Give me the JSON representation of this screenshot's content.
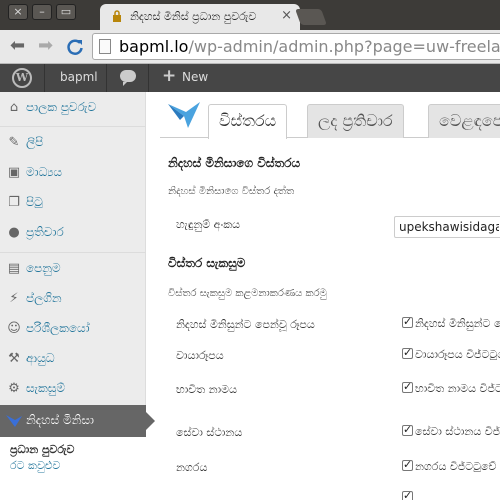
{
  "browser": {
    "tab_title": "නිදහස් මිනිස් ප්‍රධාන පුවරුව",
    "tab_close": "×",
    "url_host": "bapml.lo",
    "url_path": "/wp-admin/admin.php?page=uw-freelancer-settings",
    "window_buttons": [
      "×",
      "–",
      "▭"
    ]
  },
  "adminbar": {
    "logo": "W",
    "site_name": "bapml",
    "new_label": "New",
    "plus": "+"
  },
  "sidebar": {
    "items": [
      {
        "icon": "dashboard-icon",
        "glyph": "⌂",
        "label": "පාලක පුවරුව"
      },
      {
        "icon": "pin-icon",
        "glyph": "✎",
        "label": "ලිපි"
      },
      {
        "icon": "media-icon",
        "glyph": "▣",
        "label": "මාධ්‍යය"
      },
      {
        "icon": "pages-icon",
        "glyph": "❐",
        "label": "පිටු"
      },
      {
        "icon": "comments-icon",
        "glyph": "●",
        "label": "ප්‍රතිචාර"
      },
      {
        "icon": "appearance-icon",
        "glyph": "▤",
        "label": "පෙනුම"
      },
      {
        "icon": "plugins-icon",
        "glyph": "⚡",
        "label": "ප්ලගින"
      },
      {
        "icon": "users-icon",
        "glyph": "☺",
        "label": "පරිශීලකයෝ"
      },
      {
        "icon": "tools-icon",
        "glyph": "⚒",
        "label": "ආයුධ"
      },
      {
        "icon": "settings-icon",
        "glyph": "⚙",
        "label": "සැකසුම්"
      }
    ],
    "active": {
      "label": "නිදහස් මිනිසා"
    },
    "submenu": [
      "ප්‍රධාන පුවරුව",
      "රට කවුළුව"
    ]
  },
  "main": {
    "tabs": [
      "විස්තරය",
      "ලද ප්‍රතිචාර",
      "වෙළඳපොළ"
    ],
    "section1_title": "නිදහස් මිනිසාගෙ විස්තරය",
    "section1_desc": "නිදහස් මිනිසාගෙ විස්තර දත්ත",
    "username_label": "හැඳුනුම් අංකය",
    "username_value": "upekshawisidaga",
    "section2_title": "විස්තර සැකසුම",
    "section2_desc": "විස්තර සැකසුම කළමනාකරණය කරමු",
    "fields": [
      {
        "label": "නිදහස් මිනිසුන්ට පෙන්වූ රූපය",
        "check_label": "නිදහස් මිනිසුන්ට පෙන්වන්න",
        "checked": true
      },
      {
        "label": "වායාරූපය",
        "check_label": "වායාරූපය විජ්ටටුවේ",
        "checked": true
      },
      {
        "label": "භාවිත නාමය",
        "check_label": "භාවිත නාමය විජ්ටටුවේ",
        "checked": true
      },
      {
        "label": "සේවා ස්ථානය",
        "check_label": "සේවා ස්ථානය විජ්ටටුවේ",
        "checked": true
      },
      {
        "label": "නගරය",
        "check_label": "නගරය විජ්ටටුවේ",
        "checked": true
      },
      {
        "label": "",
        "check_label": "",
        "checked": true
      }
    ]
  },
  "colors": {
    "link": "#21759b",
    "adminbar": "#464646",
    "sidebar_bg": "#ececec",
    "active_menu": "#666666",
    "reload_icon": "#2a6db5"
  }
}
